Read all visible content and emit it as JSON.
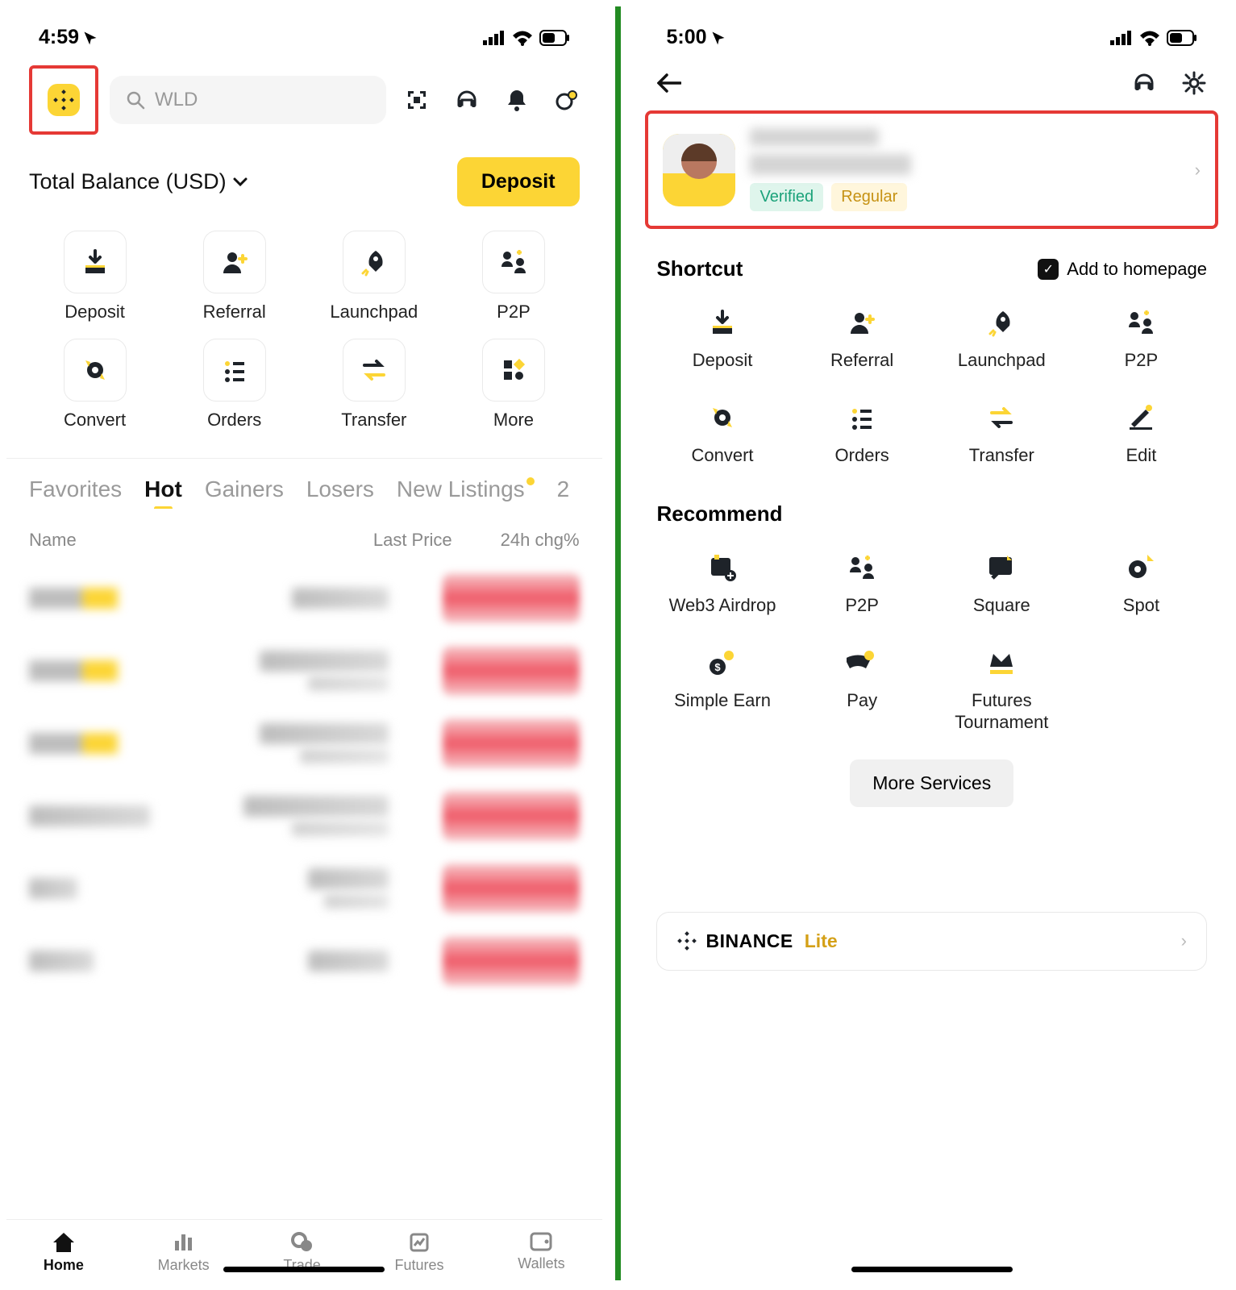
{
  "screen1": {
    "status_time": "4:59",
    "search_placeholder": "WLD",
    "balance_label": "Total Balance (USD)",
    "deposit_btn": "Deposit",
    "shortcuts": [
      "Deposit",
      "Referral",
      "Launchpad",
      "P2P",
      "Convert",
      "Orders",
      "Transfer",
      "More"
    ],
    "tabs": [
      "Favorites",
      "Hot",
      "Gainers",
      "Losers",
      "New Listings",
      "2"
    ],
    "active_tab_index": 1,
    "list_header": {
      "name": "Name",
      "price": "Last Price",
      "chg": "24h chg%"
    },
    "nav": [
      "Home",
      "Markets",
      "Trade",
      "Futures",
      "Wallets"
    ],
    "active_nav_index": 0
  },
  "screen2": {
    "status_time": "5:00",
    "badges": {
      "verified": "Verified",
      "regular": "Regular"
    },
    "shortcut_title": "Shortcut",
    "add_homepage": "Add to homepage",
    "shortcuts": [
      "Deposit",
      "Referral",
      "Launchpad",
      "P2P",
      "Convert",
      "Orders",
      "Transfer",
      "Edit"
    ],
    "recommend_title": "Recommend",
    "recommend": [
      "Web3 Airdrop",
      "P2P",
      "Square",
      "Spot",
      "Simple Earn",
      "Pay",
      "Futures Tournament"
    ],
    "more_services": "More Services",
    "brand": "BINANCE",
    "lite": "Lite"
  }
}
